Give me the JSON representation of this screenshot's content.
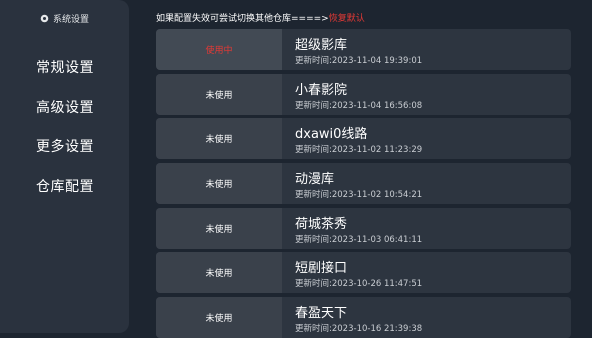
{
  "sidebar": {
    "title": "系统设置",
    "items": [
      {
        "label": "常规设置"
      },
      {
        "label": "高级设置"
      },
      {
        "label": "更多设置"
      },
      {
        "label": "仓库配置"
      }
    ]
  },
  "notice": {
    "text": "如果配置失效可尝试切换其他仓库====>",
    "restore_label": "恢复默认"
  },
  "repos": [
    {
      "status": "使用中",
      "name": "超级影库",
      "updated": "更新时间:2023-11-04 19:39:01"
    },
    {
      "status": "未使用",
      "name": "小春影院",
      "updated": "更新时间:2023-11-04 16:56:08"
    },
    {
      "status": "未使用",
      "name": "dxawi0线路",
      "updated": "更新时间:2023-11-02 11:23:29"
    },
    {
      "status": "未使用",
      "name": "动漫库",
      "updated": "更新时间:2023-11-02 10:54:21"
    },
    {
      "status": "未使用",
      "name": "荷城茶秀",
      "updated": "更新时间:2023-11-03 06:41:11"
    },
    {
      "status": "未使用",
      "name": "短剧接口",
      "updated": "更新时间:2023-10-26 11:47:51"
    },
    {
      "status": "未使用",
      "name": "春盈天下",
      "updated": "更新时间:2023-10-16 21:39:38"
    }
  ],
  "colors": {
    "background": "#1d2530",
    "sidebar": "#2a323e",
    "row": "#2d3540",
    "status_box": "#3a414b",
    "accent_red": "#e53935"
  }
}
